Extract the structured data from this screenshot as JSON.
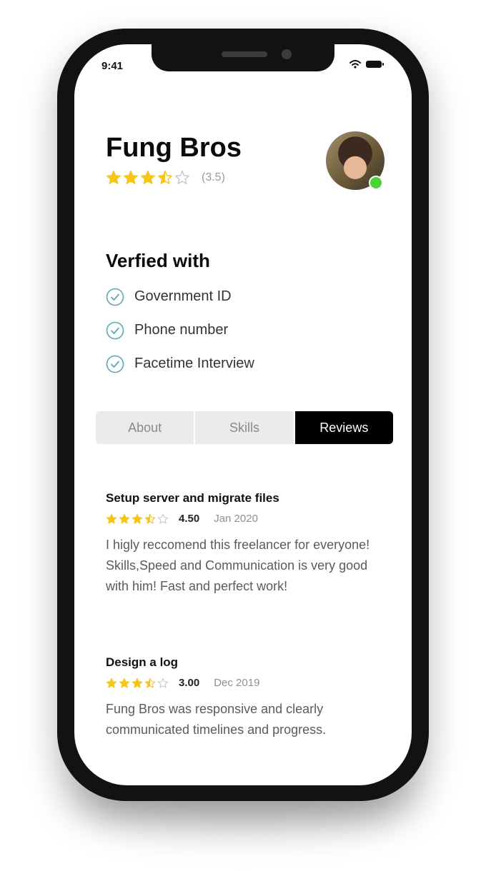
{
  "status_bar": {
    "time": "9:41"
  },
  "profile": {
    "name": "Fung Bros",
    "rating": 3.5,
    "rating_label": "(3.5)"
  },
  "verified": {
    "title": "Verfied with",
    "items": [
      {
        "label": "Government ID"
      },
      {
        "label": "Phone number"
      },
      {
        "label": "Facetime Interview"
      }
    ]
  },
  "tabs": [
    {
      "label": "About",
      "active": false
    },
    {
      "label": "Skills",
      "active": false
    },
    {
      "label": "Reviews",
      "active": true
    }
  ],
  "reviews": [
    {
      "title": "Setup server and migrate files",
      "stars": 3.5,
      "score": "4.50",
      "date": "Jan 2020",
      "text": "I higly reccomend this freelancer for everyone! Skills,Speed and Communication is very good with him! Fast and perfect work!"
    },
    {
      "title": "Design a log",
      "stars": 3.5,
      "score": "3.00",
      "date": "Dec 2019",
      "text": "Fung Bros was responsive and clearly communicated timelines and progress."
    }
  ],
  "colors": {
    "star": "#f5c518",
    "star_outline": "#c9c9c9",
    "check": "#5aa9b8",
    "online": "#4cd137",
    "active_tab": "#000000"
  }
}
